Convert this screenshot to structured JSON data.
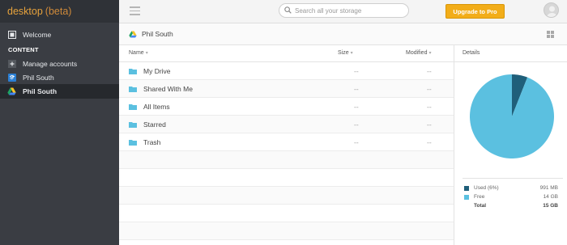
{
  "app": {
    "brand_name": "desktop",
    "brand_suffix": "(beta)"
  },
  "sidebar": {
    "section_label": "CONTENT",
    "items": [
      {
        "label": "Welcome",
        "icon": "welcome-icon"
      },
      {
        "label": "Manage accounts",
        "icon": "plus-icon"
      },
      {
        "label": "Phil South",
        "icon": "dropbox-icon"
      },
      {
        "label": "Phil South",
        "icon": "google-drive-icon"
      }
    ]
  },
  "topbar": {
    "search_placeholder": "Search all your storage",
    "upgrade_label": "Upgrade to Pro"
  },
  "breadcrumb": {
    "label": "Phil South"
  },
  "table": {
    "headers": {
      "name": "Name",
      "size": "Size",
      "modified": "Modified"
    },
    "rows": [
      {
        "name": "My Drive",
        "size": "--",
        "modified": "--"
      },
      {
        "name": "Shared With Me",
        "size": "--",
        "modified": "--"
      },
      {
        "name": "All Items",
        "size": "--",
        "modified": "--"
      },
      {
        "name": "Starred",
        "size": "--",
        "modified": "--"
      },
      {
        "name": "Trash",
        "size": "--",
        "modified": "--"
      }
    ]
  },
  "details": {
    "title": "Details",
    "used_label": "Used (6%)",
    "used_value": "991 MB",
    "free_label": "Free",
    "free_value": "14 GB",
    "total_label": "Total",
    "total_value": "15 GB"
  },
  "chart_data": {
    "type": "pie",
    "slices": [
      {
        "label": "Used (6%)",
        "value": 6,
        "color": "#1f5f7a"
      },
      {
        "label": "Free",
        "value": 94,
        "color": "#5bc0e0"
      }
    ]
  },
  "colors": {
    "sidebar_bg": "#3a3d43",
    "brand_accent": "#e6a23c",
    "upgrade_bg": "#f2ad19",
    "folder_blue": "#5bc0e0",
    "used_dark": "#1f5f7a"
  }
}
